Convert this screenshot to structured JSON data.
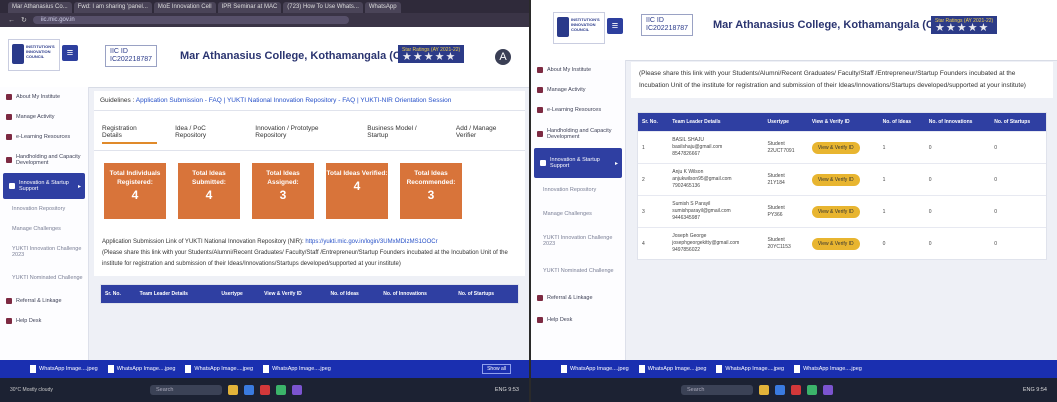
{
  "left": {
    "tabs": [
      "Mar Athanasius Co...",
      "Fwd: I am sharing 'panel...",
      "MoE Innovation Cell",
      "IPR Seminar at MAC",
      "(723) How To Use Whats...",
      "WhatsApp"
    ],
    "address": "iic.mic.gov.in",
    "header": {
      "logo_text": "INSTITUTION'S INNOVATION COUNCIL",
      "iic_id_label": "IIC ID",
      "iic_id": "IC202218787",
      "college": "Mar Athanasius College, Kothamangala (C-11815)",
      "rating_label": "Star Ratings (AY 2021-22)",
      "stars": "★★★★★",
      "avatar": "A"
    },
    "sidebar": [
      {
        "label": "About My Institute",
        "state": "normal"
      },
      {
        "label": "Manage Activity",
        "state": "normal"
      },
      {
        "label": "e-Learning Resources",
        "state": "normal"
      },
      {
        "label": "Handholding and Capacity Development",
        "state": "normal"
      },
      {
        "label": "Innovation & Startup Support",
        "state": "active"
      },
      {
        "label": "Innovation Repository",
        "state": "sub"
      },
      {
        "label": "Manage Challenges",
        "state": "sub"
      },
      {
        "label": "YUKTI Innovation Challenge 2023",
        "state": "sub"
      },
      {
        "label": "YUKTI Nominated Challenge",
        "state": "sub"
      },
      {
        "label": "Referral & Linkage",
        "state": "normal"
      },
      {
        "label": "Help Desk",
        "state": "normal"
      }
    ],
    "guidelines": {
      "prefix": "Guidelines :",
      "links": "Application Submission - FAQ | YUKTI National Innovation Repository - FAQ | YUKTI-NIR Orientation Session"
    },
    "tabs_row": [
      "Registration Details",
      "Idea / PoC Repository",
      "Innovation / Prototype Repository",
      "Business Model / Startup",
      "Add / Manage Verifier"
    ],
    "cards": [
      {
        "label": "Total Individuals Registered:",
        "value": "4"
      },
      {
        "label": "Total Ideas Submitted:",
        "value": "4"
      },
      {
        "label": "Total Ideas Assigned:",
        "value": "3"
      },
      {
        "label": "Total Ideas Verified:",
        "value": "4"
      },
      {
        "label": "Total Ideas Recommended:",
        "value": "3"
      }
    ],
    "submission_link_label": "Application Submission Link of YUKTI National Innovation Repository (NIR):",
    "submission_link": "https://yukti.mic.gov.in/login/3UMxMDIzMS1OOCr",
    "share_text": "(Please share this link with your Students/Alumni/Recent Graduates/ Faculty/Staff /Entrepreneur/Startup Founders incubated at the Incubation Unit of the institute for registration and submission of their Ideas/Innovations/Startups developed/supported at your institute)",
    "table_headers": [
      "Sr. No.",
      "Team Leader Details",
      "Usertype",
      "View & Verify ID",
      "No. of Ideas",
      "No. of Innovations",
      "No. of Startups"
    ],
    "taskbar": {
      "downloads": [
        "WhatsApp Image....jpeg",
        "WhatsApp Image....jpeg",
        "WhatsApp Image....jpeg",
        "WhatsApp Image....jpeg"
      ],
      "show_all": "Show all",
      "search": "Search",
      "weather": "30°C Mostly cloudy",
      "clock": "ENG 9:53"
    }
  },
  "right": {
    "header": {
      "iic_id_label": "IIC ID",
      "iic_id": "IC202218787",
      "college": "Mar Athanasius College, Kothamangala (C-11815)",
      "rating_label": "Star Ratings (AY 2021-22)",
      "stars": "★★★★★"
    },
    "sidebar": [
      {
        "label": "About My Institute",
        "state": "normal"
      },
      {
        "label": "Manage Activity",
        "state": "normal"
      },
      {
        "label": "e-Learning Resources",
        "state": "normal"
      },
      {
        "label": "Handholding and Capacity Development",
        "state": "normal"
      },
      {
        "label": "Innovation & Startup Support",
        "state": "active"
      },
      {
        "label": "Innovation Repository",
        "state": "sub"
      },
      {
        "label": "Manage Challenges",
        "state": "sub"
      },
      {
        "label": "YUKTI Innovation Challenge 2023",
        "state": "sub"
      },
      {
        "label": "YUKTI Nominated Challenge",
        "state": "sub"
      },
      {
        "label": "Referral & Linkage",
        "state": "normal"
      },
      {
        "label": "Help Desk",
        "state": "normal"
      }
    ],
    "share_text": "(Please share this link with your Students/Alumni/Recent Graduates/ Faculty/Staff /Entrepreneur/Startup Founders incubated at the Incubation Unit of the institute for registration and submission of their Ideas/Innovations/Startups developed/supported at your institute)",
    "table_headers": [
      "Sr. No.",
      "Team Leader Details",
      "Usertype",
      "View & Verify ID",
      "No. of Ideas",
      "No. of Innovations",
      "No. of Startups"
    ],
    "rows": [
      {
        "sr": "1",
        "name": "BASIL SHAJU",
        "email": "basilshaju@gmail.com",
        "phone": "8547826667",
        "usertype": "Student",
        "uid": "22UCT7091",
        "button": "View & Verify ID",
        "ideas": "1",
        "innovations": "0",
        "startups": "0"
      },
      {
        "sr": "2",
        "name": "Anju K Wilson",
        "email": "anjukwilson95@gmail.com",
        "phone": "7902465136",
        "usertype": "Student",
        "uid": "21Y184",
        "button": "View & Verify ID",
        "ideas": "1",
        "innovations": "0",
        "startups": "0"
      },
      {
        "sr": "3",
        "name": "Sumish S Parayil",
        "email": "sumishparayil@gmail.com",
        "phone": "9446345987",
        "usertype": "Student",
        "uid": "PY366",
        "button": "View & Verify ID",
        "ideas": "1",
        "innovations": "0",
        "startups": "0"
      },
      {
        "sr": "4",
        "name": "Joseph George",
        "email": "josephgeorgekitty@gmail.com",
        "phone": "9497856022",
        "usertype": "Student",
        "uid": "20YC1153",
        "button": "View & Verify ID",
        "ideas": "0",
        "innovations": "0",
        "startups": "0"
      }
    ],
    "taskbar": {
      "downloads": [
        "WhatsApp Image....jpeg",
        "WhatsApp Image....jpeg",
        "WhatsApp Image....jpeg",
        "WhatsApp Image....jpeg"
      ],
      "search": "Search",
      "clock": "ENG 9:54"
    }
  }
}
